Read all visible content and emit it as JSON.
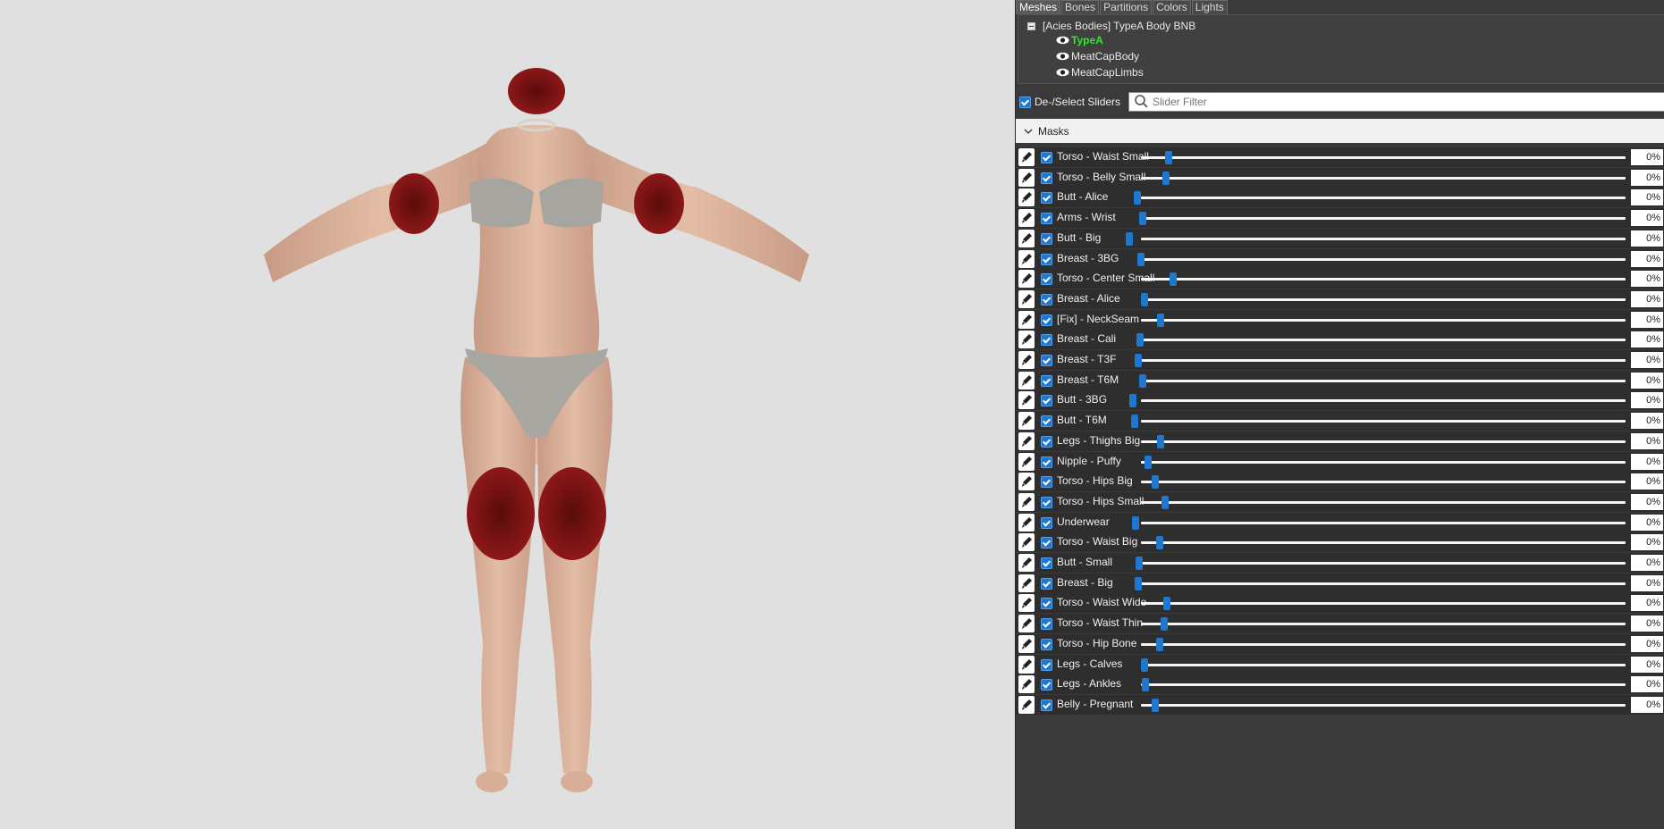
{
  "tabs": [
    "Meshes",
    "Bones",
    "Partitions",
    "Colors",
    "Lights"
  ],
  "tree": {
    "root": "[Acies Bodies] TypeA Body BNB",
    "children": [
      {
        "label": "TypeA",
        "active": true
      },
      {
        "label": "MeatCapBody",
        "active": false
      },
      {
        "label": "MeatCapLimbs",
        "active": false
      }
    ]
  },
  "filter": {
    "deselect_label": "De-/Select Sliders",
    "placeholder": "Slider Filter"
  },
  "masks_label": "Masks",
  "colors": {
    "accent": "#1e78d0",
    "active_mesh": "#33e633",
    "panel_bg": "#3a3a3a"
  },
  "sliders": [
    {
      "label": "Torso - Waist Small",
      "value": "0%"
    },
    {
      "label": "Torso - Belly Small",
      "value": "0%"
    },
    {
      "label": "Butt - Alice",
      "value": "0%"
    },
    {
      "label": "Arms - Wrist",
      "value": "0%"
    },
    {
      "label": "Butt - Big",
      "value": "0%"
    },
    {
      "label": "Breast - 3BG",
      "value": "0%"
    },
    {
      "label": "Torso - Center Small",
      "value": "0%"
    },
    {
      "label": "Breast - Alice",
      "value": "0%"
    },
    {
      "label": "[Fix] - NeckSeam",
      "value": "0%"
    },
    {
      "label": "Breast - Cali",
      "value": "0%"
    },
    {
      "label": "Breast - T3F",
      "value": "0%"
    },
    {
      "label": "Breast - T6M",
      "value": "0%"
    },
    {
      "label": "Butt - 3BG",
      "value": "0%"
    },
    {
      "label": "Butt - T6M",
      "value": "0%"
    },
    {
      "label": "Legs - Thighs Big",
      "value": "0%"
    },
    {
      "label": "Nipple - Puffy",
      "value": "0%"
    },
    {
      "label": "Torso - Hips Big",
      "value": "0%"
    },
    {
      "label": "Torso - Hips Small",
      "value": "0%"
    },
    {
      "label": "Underwear",
      "value": "0%"
    },
    {
      "label": "Torso - Waist Big",
      "value": "0%"
    },
    {
      "label": "Butt - Small",
      "value": "0%"
    },
    {
      "label": "Breast - Big",
      "value": "0%"
    },
    {
      "label": "Torso - Waist Wide",
      "value": "0%"
    },
    {
      "label": "Torso - Waist Thin",
      "value": "0%"
    },
    {
      "label": "Torso - Hip Bone",
      "value": "0%"
    },
    {
      "label": "Legs - Calves",
      "value": "0%"
    },
    {
      "label": "Legs - Ankles",
      "value": "0%"
    },
    {
      "label": "Belly - Pregnant",
      "value": "0%"
    }
  ]
}
